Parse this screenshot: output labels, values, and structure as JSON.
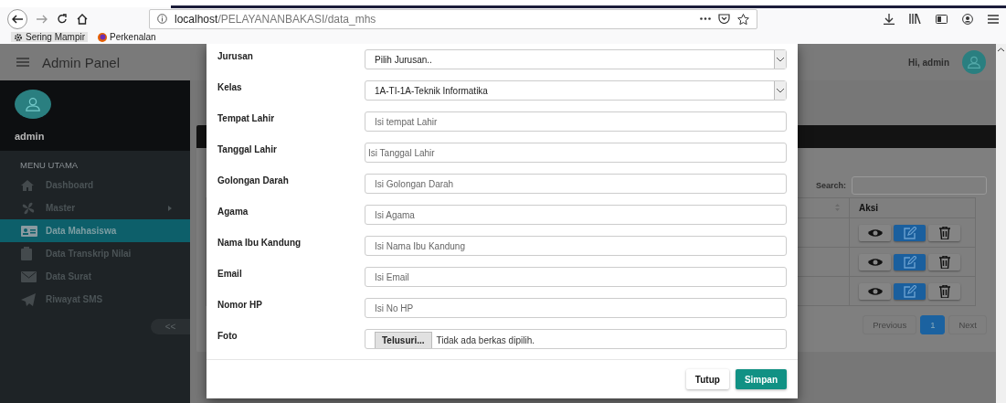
{
  "browser": {
    "url_host": "localhost",
    "url_path": "/PELAYANANBAKASI/data_mhs",
    "bookmarks": [
      "Sering Mampir",
      "Perkenalan"
    ]
  },
  "header": {
    "title": "Admin Panel",
    "greeting": "Hi, admin"
  },
  "sidebar": {
    "user": "admin",
    "section": "MENU UTAMA",
    "items": [
      {
        "label": "Dashboard",
        "selected": false,
        "has_submenu": false
      },
      {
        "label": "Master",
        "selected": false,
        "has_submenu": true
      },
      {
        "label": "Data Mahasiswa",
        "selected": true,
        "has_submenu": false
      },
      {
        "label": "Data Transkrip Nilai",
        "selected": false,
        "has_submenu": false
      },
      {
        "label": "Data Surat",
        "selected": false,
        "has_submenu": false
      },
      {
        "label": "Riwayat SMS",
        "selected": false,
        "has_submenu": false
      }
    ],
    "collapse": "<<"
  },
  "table": {
    "search_label": "Search:",
    "action_header": "Aksi",
    "rows": [
      {
        "actions": [
          {
            "kind": "view"
          },
          {
            "kind": "edit"
          },
          {
            "kind": "delete"
          }
        ]
      },
      {
        "actions": [
          {
            "kind": "view"
          },
          {
            "kind": "edit"
          },
          {
            "kind": "delete"
          }
        ]
      },
      {
        "actions": [
          {
            "kind": "view"
          },
          {
            "kind": "edit"
          },
          {
            "kind": "delete"
          }
        ]
      }
    ],
    "pagination": {
      "previous": "Previous",
      "pages": [
        {
          "label": "1",
          "selected": true
        }
      ],
      "next": "Next"
    }
  },
  "modal": {
    "fields": [
      {
        "label": "Jurusan",
        "kind": "select",
        "value": "Pilih Jurusan.."
      },
      {
        "label": "Kelas",
        "kind": "select",
        "value": "1A-TI-1A-Teknik Informatika"
      },
      {
        "label": "Tempat Lahir",
        "kind": "text",
        "placeholder": "Isi tempat Lahir"
      },
      {
        "label": "Tanggal Lahir",
        "kind": "date",
        "placeholder": "Isi Tanggal Lahir"
      },
      {
        "label": "Golongan Darah",
        "kind": "text",
        "placeholder": "Isi Golongan Darah"
      },
      {
        "label": "Agama",
        "kind": "text",
        "placeholder": "Isi Agama"
      },
      {
        "label": "Nama Ibu Kandung",
        "kind": "text",
        "placeholder": "Isi Nama Ibu Kandung"
      },
      {
        "label": "Email",
        "kind": "text",
        "placeholder": "Isi Email"
      },
      {
        "label": "Nomor HP",
        "kind": "text",
        "placeholder": "Isi No HP"
      },
      {
        "label": "Foto",
        "kind": "file",
        "button": "Telusuri...",
        "status": "Tidak ada berkas dipilih."
      }
    ],
    "buttons": [
      {
        "label": "Tutup",
        "kind": "default"
      },
      {
        "label": "Simpan",
        "kind": "primary"
      }
    ]
  }
}
